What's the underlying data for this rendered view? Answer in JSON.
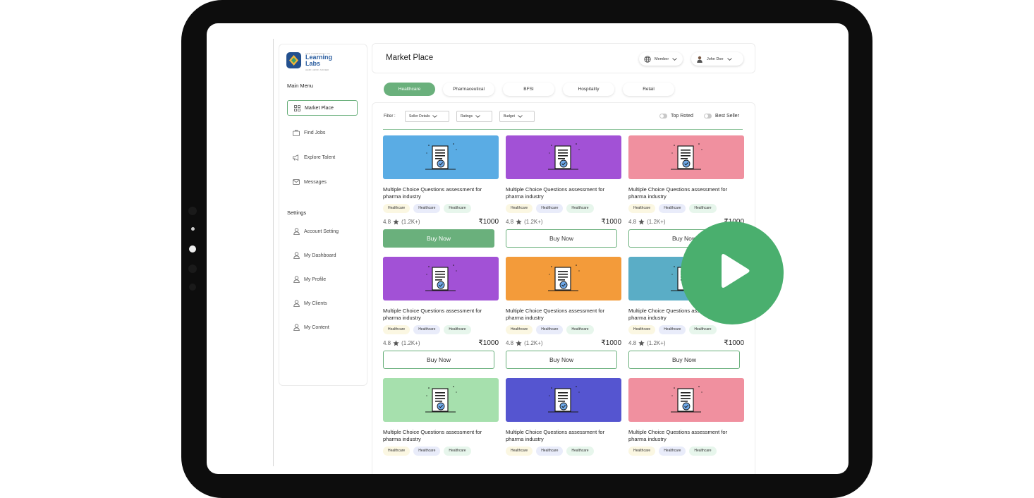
{
  "colors": {
    "accent": "#6ab07c",
    "play_button": "#4aaf6e",
    "bezel": "#0d0d0d"
  },
  "logo": {
    "small_text": "THE COMMUNITY OF",
    "name_line1": "Learning",
    "name_line2": "Labs",
    "tagline": "LEARN • GROW • SUCCEED"
  },
  "sidebar": {
    "main_menu_heading": "Main Menu",
    "main_items": [
      {
        "label": "Market Place",
        "icon": "grid-icon"
      },
      {
        "label": "Find Jobs",
        "icon": "briefcase-icon"
      },
      {
        "label": "Explore Talent",
        "icon": "megaphone-icon"
      },
      {
        "label": "Messages",
        "icon": "mail-icon"
      }
    ],
    "settings_heading": "Settings",
    "settings_items": [
      {
        "label": "Account Setting",
        "icon": "user-icon"
      },
      {
        "label": "My Dashboard",
        "icon": "user-icon"
      },
      {
        "label": "My Profile",
        "icon": "user-icon"
      },
      {
        "label": "My Clients",
        "icon": "user-icon"
      },
      {
        "label": "My Content",
        "icon": "user-icon"
      }
    ]
  },
  "header": {
    "title": "Market Place",
    "member_label": "Member",
    "user_name": "John Doe"
  },
  "categories": [
    "Healthcare",
    "Pharmaceutical",
    "BFSI",
    "Hospitality",
    "Retail"
  ],
  "filters": {
    "label": "Filter :",
    "dropdowns": [
      "Seller Details",
      "Ratings",
      "Budget"
    ],
    "toggles": [
      "Top Roted",
      "Best Seller"
    ]
  },
  "cards": [
    {
      "title": "Multiple Choice Questions assessment for pharma industry",
      "color": "#5aace4",
      "tags": [
        "Healthcare",
        "Healthcare",
        "Healthcare"
      ],
      "rating": "4.8",
      "reviews": "(1.2K+)",
      "price": "₹1000",
      "button": "Buy Now"
    },
    {
      "title": "Multiple Choice Questions assessment for pharma industry",
      "color": "#a251d6",
      "tags": [
        "Healthcare",
        "Healthcare",
        "Healthcare"
      ],
      "rating": "4.8",
      "reviews": "(1.2K+)",
      "price": "₹1000",
      "button": "Buy Now"
    },
    {
      "title": "Multiple Choice Questions assessment for pharma industry",
      "color": "#f0909f",
      "tags": [
        "Healthcare",
        "Healthcare",
        "Healthcare"
      ],
      "rating": "4.8",
      "reviews": "(1.2K+)",
      "price": "₹1000",
      "button": "Buy Now"
    },
    {
      "title": "Multiple Choice Questions assessment for pharma industry",
      "color": "#a251d6",
      "tags": [
        "Healthcare",
        "Healthcare",
        "Healthcare"
      ],
      "rating": "4.8",
      "reviews": "(1.2K+)",
      "price": "₹1000",
      "button": "Buy Now"
    },
    {
      "title": "Multiple Choice Questions assessment for pharma industry",
      "color": "#f39b3a",
      "tags": [
        "Healthcare",
        "Healthcare",
        "Healthcare"
      ],
      "rating": "4.8",
      "reviews": "(1.2K+)",
      "price": "₹1000",
      "button": "Buy Now"
    },
    {
      "title": "Multiple Choice Questions assessment for pharma industry",
      "color": "#5aadc6",
      "tags": [
        "Healthcare",
        "Healthcare",
        "Healthcare"
      ],
      "rating": "4.8",
      "reviews": "(1.2K+)",
      "price": "₹1000",
      "button": "Buy Now"
    },
    {
      "title": "Multiple Choice Questions assessment for pharma industry",
      "color": "#a6e0ad",
      "tags": [
        "Healthcare",
        "Healthcare",
        "Healthcare"
      ]
    },
    {
      "title": "Multiple Choice Questions assessment for pharma industry",
      "color": "#5555d0",
      "tags": [
        "Healthcare",
        "Healthcare",
        "Healthcare"
      ]
    },
    {
      "title": "Multiple Choice Questions assessment for pharma industry",
      "color": "#f0909f",
      "tags": [
        "Healthcare",
        "Healthcare",
        "Healthcare"
      ]
    }
  ]
}
